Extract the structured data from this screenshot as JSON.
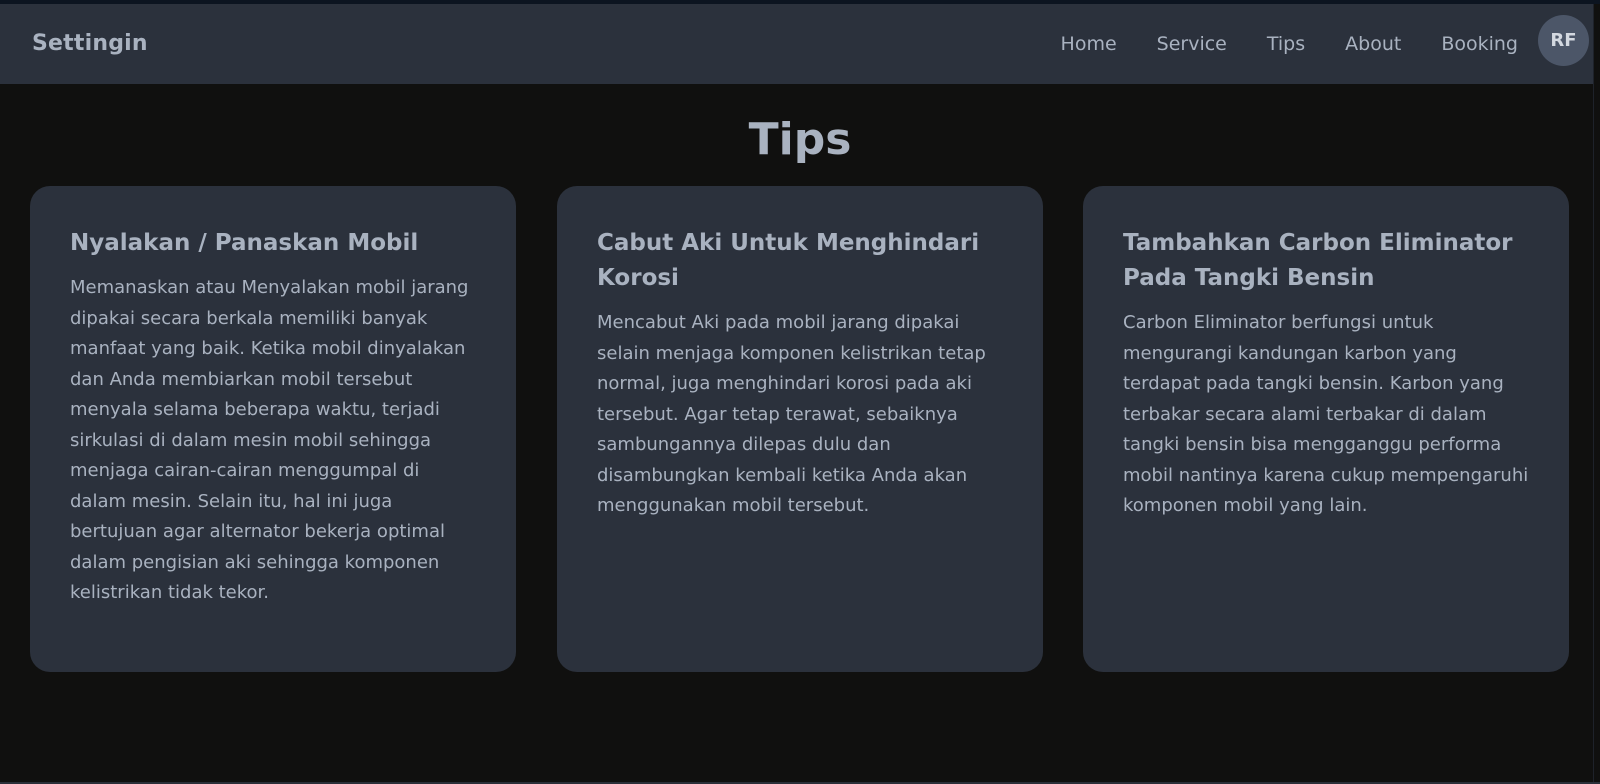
{
  "navbar": {
    "brand": "Settingin",
    "links": [
      "Home",
      "Service",
      "Tips",
      "About",
      "Booking"
    ],
    "avatar_initials": "RF"
  },
  "page": {
    "title": "Tips"
  },
  "cards": [
    {
      "title": "Nyalakan / Panaskan Mobil",
      "body": "Memanaskan atau Menyalakan mobil jarang dipakai secara berkala memiliki banyak manfaat yang baik. Ketika mobil dinyalakan dan Anda membiarkan mobil tersebut menyala selama beberapa waktu, terjadi sirkulasi di dalam mesin mobil sehingga menjaga cairan-cairan menggumpal di dalam mesin. Selain itu, hal ini juga bertujuan agar alternator bekerja optimal dalam pengisian aki sehingga komponen kelistrikan tidak tekor."
    },
    {
      "title": "Cabut Aki Untuk Menghindari Korosi",
      "body": "Mencabut Aki pada mobil jarang dipakai selain menjaga komponen kelistrikan tetap normal, juga menghindari korosi pada aki tersebut. Agar tetap terawat, sebaiknya sambungannya dilepas dulu dan disambungkan kembali ketika Anda akan menggunakan mobil tersebut."
    },
    {
      "title": "Tambahkan Carbon Eliminator Pada Tangki Bensin",
      "body": "Carbon Eliminator berfungsi untuk mengurangi kandungan karbon yang terdapat pada tangki bensin. Karbon yang terbakar secara alami terbakar di dalam tangki bensin bisa mengganggu performa mobil nantinya karena cukup mempengaruhi komponen mobil yang lain."
    }
  ],
  "colors": {
    "background": "#10100f",
    "navbar": "#2b313c",
    "card": "#2b313c",
    "text": "#a9b2c0",
    "avatar": "#4c5668"
  }
}
